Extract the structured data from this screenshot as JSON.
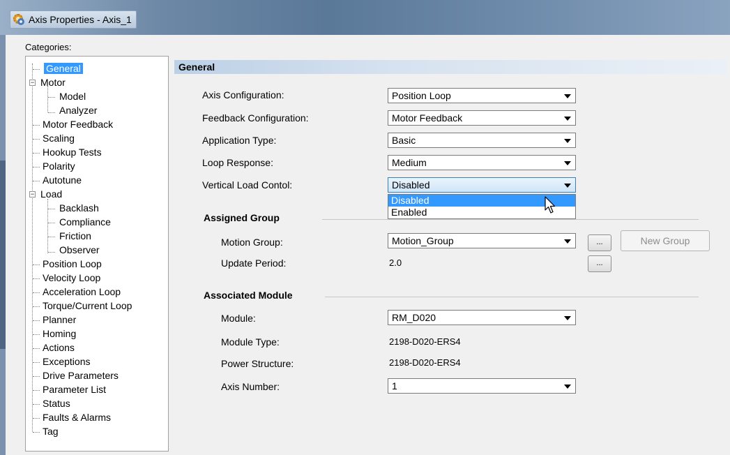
{
  "window": {
    "title": "Axis Properties - Axis_1",
    "icon": "axis-properties-icon"
  },
  "categories": {
    "label": "Categories:",
    "items": [
      {
        "label": "General",
        "selected": true
      },
      {
        "label": "Motor",
        "expander": "−"
      },
      {
        "label": "Model"
      },
      {
        "label": "Analyzer"
      },
      {
        "label": "Motor Feedback"
      },
      {
        "label": "Scaling"
      },
      {
        "label": "Hookup Tests"
      },
      {
        "label": "Polarity"
      },
      {
        "label": "Autotune"
      },
      {
        "label": "Load",
        "expander": "−"
      },
      {
        "label": "Backlash"
      },
      {
        "label": "Compliance"
      },
      {
        "label": "Friction"
      },
      {
        "label": "Observer"
      },
      {
        "label": "Position Loop"
      },
      {
        "label": "Velocity Loop"
      },
      {
        "label": "Acceleration Loop"
      },
      {
        "label": "Torque/Current Loop"
      },
      {
        "label": "Planner"
      },
      {
        "label": "Homing"
      },
      {
        "label": "Actions"
      },
      {
        "label": "Exceptions"
      },
      {
        "label": "Drive Parameters"
      },
      {
        "label": "Parameter List"
      },
      {
        "label": "Status"
      },
      {
        "label": "Faults & Alarms"
      },
      {
        "label": "Tag"
      }
    ]
  },
  "general": {
    "header": "General",
    "axis_configuration": {
      "label": "Axis Configuration:",
      "value": "Position Loop"
    },
    "feedback_configuration": {
      "label": "Feedback Configuration:",
      "value": "Motor Feedback"
    },
    "application_type": {
      "label": "Application Type:",
      "value": "Basic"
    },
    "loop_response": {
      "label": "Loop Response:",
      "value": "Medium"
    },
    "vertical_load_control": {
      "label": "Vertical Load Contol:",
      "value": "Disabled",
      "options": [
        "Disabled",
        "Enabled"
      ],
      "highlighted_option": "Disabled"
    }
  },
  "assigned_group": {
    "title": "Assigned Group",
    "motion_group": {
      "label": "Motion Group:",
      "value": "Motion_Group"
    },
    "update_period": {
      "label": "Update Period:",
      "value": "2.0"
    },
    "ellipsis": "...",
    "new_group_button": "New Group"
  },
  "associated_module": {
    "title": "Associated Module",
    "module": {
      "label": "Module:",
      "value": "RM_D020"
    },
    "module_type": {
      "label": "Module Type:",
      "value": "2198-D020-ERS4"
    },
    "power_structure": {
      "label": "Power Structure:",
      "value": "2198-D020-ERS4"
    },
    "axis_number": {
      "label": "Axis Number:",
      "value": "1"
    }
  },
  "colors": {
    "selection": "#3399ff",
    "title_bar": "#5a7898",
    "header_gradient": "#bcd0e6"
  }
}
